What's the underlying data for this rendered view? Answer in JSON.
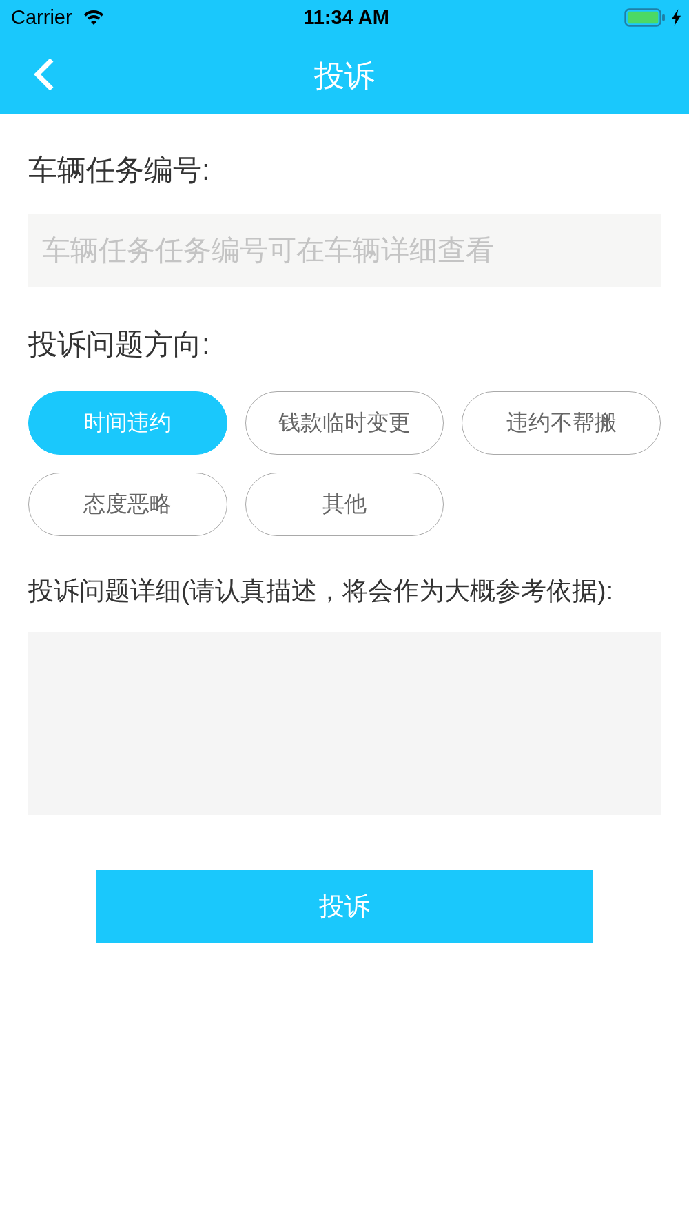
{
  "status_bar": {
    "carrier": "Carrier",
    "time": "11:34 AM"
  },
  "nav_bar": {
    "title": "投诉"
  },
  "form": {
    "task_number": {
      "label": "车辆任务编号:",
      "placeholder": "车辆任务任务编号可在车辆详细查看"
    },
    "direction": {
      "label": "投诉问题方向:",
      "options": [
        {
          "label": "时间违约",
          "selected": true
        },
        {
          "label": "钱款临时变更",
          "selected": false
        },
        {
          "label": "违约不帮搬",
          "selected": false
        },
        {
          "label": "态度恶略",
          "selected": false
        },
        {
          "label": "其他",
          "selected": false
        }
      ]
    },
    "details": {
      "label": "投诉问题详细(请认真描述，将会作为大概参考依据):"
    },
    "submit": {
      "label": "投诉"
    }
  }
}
